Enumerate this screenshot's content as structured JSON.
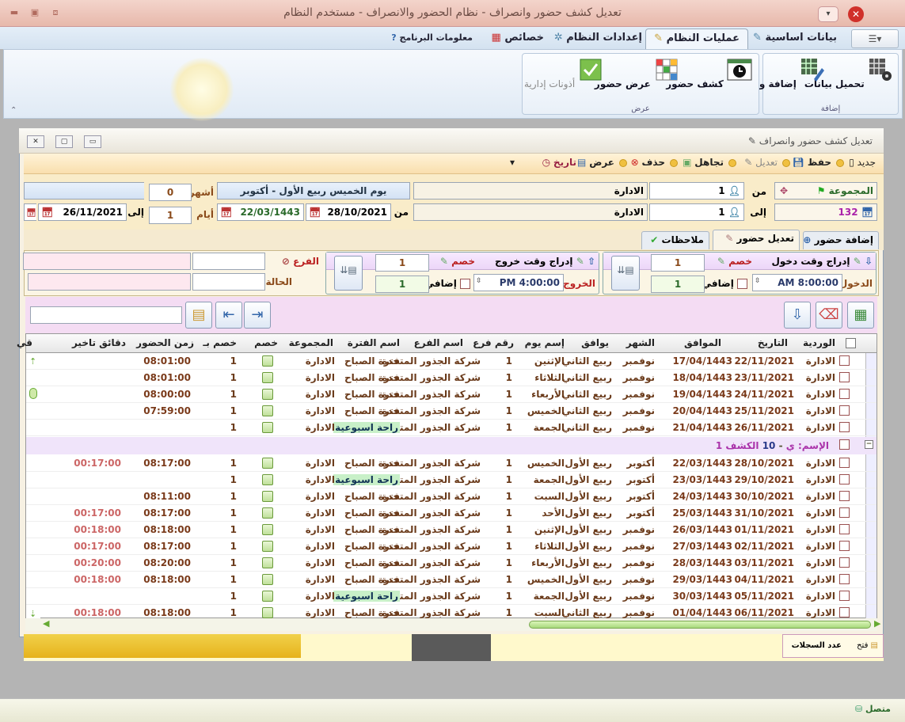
{
  "window": {
    "title": "تعديل كشف حضور وانصراف  - نظام الحضور والانصراف -  مستخدم النظام"
  },
  "ribbon_tabs": [
    {
      "label": "بيانات اساسية"
    },
    {
      "label": "عمليات النظام"
    },
    {
      "label": "إعدادات النظام"
    },
    {
      "label": "خصائص"
    },
    {
      "label": "معلومات البرنامج"
    }
  ],
  "ribbon": {
    "groups": [
      {
        "label": "إضافة",
        "buttons": [
          "تحميل بيانات",
          "إضافة وتعديل"
        ]
      },
      {
        "label": "عرض",
        "buttons": [
          "كشف حضور",
          "عرض حضور",
          "أذونات إدارية"
        ]
      }
    ]
  },
  "mdi": {
    "title": "تعديل كشف حضور وانصراف"
  },
  "toolbar": {
    "new": "جديد",
    "save": "حفظ",
    "edit": "تعديل",
    "ignore": "تجاهل",
    "delete": "حذف",
    "view": "عرض",
    "date": "تاريخ"
  },
  "form": {
    "group_label": "المجموعة",
    "count": "132",
    "from_label": "من",
    "to_label": "إلى",
    "from_num": "1",
    "to_num": "1",
    "from_dept": "الادارة",
    "to_dept": "الادارة",
    "date_banner": "يوم الخميس  ربيع الأول - أكتوبر",
    "from_date_label": "من",
    "from_date_g": "28/10/2021",
    "from_date_h": "22/03/1443",
    "months_label": "أشهر",
    "months_value": "0",
    "days_label": "أيام",
    "days_value": "1",
    "to_date_label": "إلى",
    "to_date": "26/11/2021"
  },
  "subtabs": [
    {
      "label": "إضافة حضور"
    },
    {
      "label": "تعديل حضور"
    },
    {
      "label": "ملاحظات"
    }
  ],
  "panel": {
    "in_label": "إدراج وقت دخول",
    "in_deduct_label": "خصم",
    "in_deduct": "1",
    "in_extra_label": "إضافي",
    "in_extra": "1",
    "entry_label": "الدخول",
    "entry_time": "8:00:00 AM",
    "out_label": "إدراج وقت خروج",
    "out_deduct_label": "خصم",
    "out_deduct": "1",
    "out_extra_label": "إضافي",
    "out_extra": "1",
    "exit_label": "الخروج",
    "exit_time": "4:00:00 PM",
    "branch_label": "الفرع",
    "status_label": "الحالة"
  },
  "grid": {
    "headers": [
      "الوردية",
      "التاريخ",
      "الموافق",
      "الشهر",
      "يوافق",
      "إسم يوم",
      "رقم فرع",
      "اسم الفرع",
      "اسم الفترة",
      "المجموعة",
      "خصم",
      "خصم بـ",
      "زمن الحضور",
      "دقائق تاخير",
      "قي"
    ],
    "rows_top": [
      {
        "shift": "الادارة",
        "date": "22/11/2021",
        "hijri": "17/04/1443",
        "month": "نوفمبر",
        "hmonth": "ربيع الثاني",
        "day": "الإثنين",
        "branch_no": "1",
        "branch": "شركة الجذور المتحدة",
        "period": "فترة الصباح",
        "group": "الادارة",
        "deduct": "1",
        "time": "08:01:00",
        "late": ""
      },
      {
        "shift": "الادارة",
        "date": "23/11/2021",
        "hijri": "18/04/1443",
        "month": "نوفمبر",
        "hmonth": "ربيع الثاني",
        "day": "الثلاثاء",
        "branch_no": "1",
        "branch": "شركة الجذور المتحدة",
        "period": "فترة الصباح",
        "group": "الادارة",
        "deduct": "1",
        "time": "08:01:00",
        "late": ""
      },
      {
        "shift": "الادارة",
        "date": "24/11/2021",
        "hijri": "19/04/1443",
        "month": "نوفمبر",
        "hmonth": "ربيع الثاني",
        "day": "الأربعاء",
        "branch_no": "1",
        "branch": "شركة الجذور المتحدة",
        "period": "فترة الصباح",
        "group": "الادارة",
        "deduct": "1",
        "time": "08:00:00",
        "late": ""
      },
      {
        "shift": "الادارة",
        "date": "25/11/2021",
        "hijri": "20/04/1443",
        "month": "نوفمبر",
        "hmonth": "ربيع الثاني",
        "day": "الخميس",
        "branch_no": "1",
        "branch": "شركة الجذور المتحدة",
        "period": "فترة الصباح",
        "group": "الادارة",
        "deduct": "1",
        "time": "07:59:00",
        "late": ""
      },
      {
        "shift": "الادارة",
        "date": "26/11/2021",
        "hijri": "21/04/1443",
        "month": "نوفمبر",
        "hmonth": "ربيع الثاني",
        "day": "الجمعة",
        "branch_no": "1",
        "branch": "شركة الجذور المتحدة",
        "period": "راحة اسبوعية",
        "group": "الادارة",
        "deduct": "1",
        "time": "",
        "late": ""
      }
    ],
    "group_row": {
      "prefix": "الإسم:",
      "name": "ي",
      "num": "10",
      "sheet": "الكشف 1"
    },
    "rows_bottom": [
      {
        "shift": "الادارة",
        "date": "28/10/2021",
        "hijri": "22/03/1443",
        "month": "أكتوبر",
        "hmonth": "ربيع الأول",
        "day": "الخميس",
        "branch_no": "1",
        "branch": "شركة الجذور المتحدة",
        "period": "فترة الصباح",
        "group": "الادارة",
        "deduct": "1",
        "time": "08:17:00",
        "late": "00:17:00"
      },
      {
        "shift": "الادارة",
        "date": "29/10/2021",
        "hijri": "23/03/1443",
        "month": "أكتوبر",
        "hmonth": "ربيع الأول",
        "day": "الجمعة",
        "branch_no": "1",
        "branch": "شركة الجذور المتحدة",
        "period": "راحة اسبوعية",
        "group": "الادارة",
        "deduct": "1",
        "time": "",
        "late": ""
      },
      {
        "shift": "الادارة",
        "date": "30/10/2021",
        "hijri": "24/03/1443",
        "month": "أكتوبر",
        "hmonth": "ربيع الأول",
        "day": "السبت",
        "branch_no": "1",
        "branch": "شركة الجذور المتحدة",
        "period": "فترة الصباح",
        "group": "الادارة",
        "deduct": "1",
        "time": "08:11:00",
        "late": ""
      },
      {
        "shift": "الادارة",
        "date": "31/10/2021",
        "hijri": "25/03/1443",
        "month": "أكتوبر",
        "hmonth": "ربيع الأول",
        "day": "الأحد",
        "branch_no": "1",
        "branch": "شركة الجذور المتحدة",
        "period": "فترة الصباح",
        "group": "الادارة",
        "deduct": "1",
        "time": "08:17:00",
        "late": "00:17:00"
      },
      {
        "shift": "الادارة",
        "date": "01/11/2021",
        "hijri": "26/03/1443",
        "month": "نوفمبر",
        "hmonth": "ربيع الأول",
        "day": "الإثنين",
        "branch_no": "1",
        "branch": "شركة الجذور المتحدة",
        "period": "فترة الصباح",
        "group": "الادارة",
        "deduct": "1",
        "time": "08:18:00",
        "late": "00:18:00"
      },
      {
        "shift": "الادارة",
        "date": "02/11/2021",
        "hijri": "27/03/1443",
        "month": "نوفمبر",
        "hmonth": "ربيع الأول",
        "day": "الثلاثاء",
        "branch_no": "1",
        "branch": "شركة الجذور المتحدة",
        "period": "فترة الصباح",
        "group": "الادارة",
        "deduct": "1",
        "time": "08:17:00",
        "late": "00:17:00"
      },
      {
        "shift": "الادارة",
        "date": "03/11/2021",
        "hijri": "28/03/1443",
        "month": "نوفمبر",
        "hmonth": "ربيع الأول",
        "day": "الأربعاء",
        "branch_no": "1",
        "branch": "شركة الجذور المتحدة",
        "period": "فترة الصباح",
        "group": "الادارة",
        "deduct": "1",
        "time": "08:20:00",
        "late": "00:20:00"
      },
      {
        "shift": "الادارة",
        "date": "04/11/2021",
        "hijri": "29/03/1443",
        "month": "نوفمبر",
        "hmonth": "ربيع الأول",
        "day": "الخميس",
        "branch_no": "1",
        "branch": "شركة الجذور المتحدة",
        "period": "فترة الصباح",
        "group": "الادارة",
        "deduct": "1",
        "time": "08:18:00",
        "late": "00:18:00"
      },
      {
        "shift": "الادارة",
        "date": "05/11/2021",
        "hijri": "30/03/1443",
        "month": "نوفمبر",
        "hmonth": "ربيع الأول",
        "day": "الجمعة",
        "branch_no": "1",
        "branch": "شركة الجذور المتحدة",
        "period": "راحة اسبوعية",
        "group": "الادارة",
        "deduct": "1",
        "time": "",
        "late": ""
      },
      {
        "shift": "الادارة",
        "date": "06/11/2021",
        "hijri": "01/04/1443",
        "month": "نوفمبر",
        "hmonth": "ربيع الثاني",
        "day": "السبت",
        "branch_no": "1",
        "branch": "شركة الجذور المتحدة",
        "period": "فترة الصباح",
        "group": "الادارة",
        "deduct": "1",
        "time": "08:18:00",
        "late": "00:18:00"
      }
    ]
  },
  "statusbar": {
    "open": "فتح",
    "records": "عدد السجلات"
  },
  "bottom": {
    "connected": "متصل"
  },
  "colors": {
    "accent": "#2a6a2a",
    "late": "#c66",
    "hijri": "#8a4a1a"
  }
}
